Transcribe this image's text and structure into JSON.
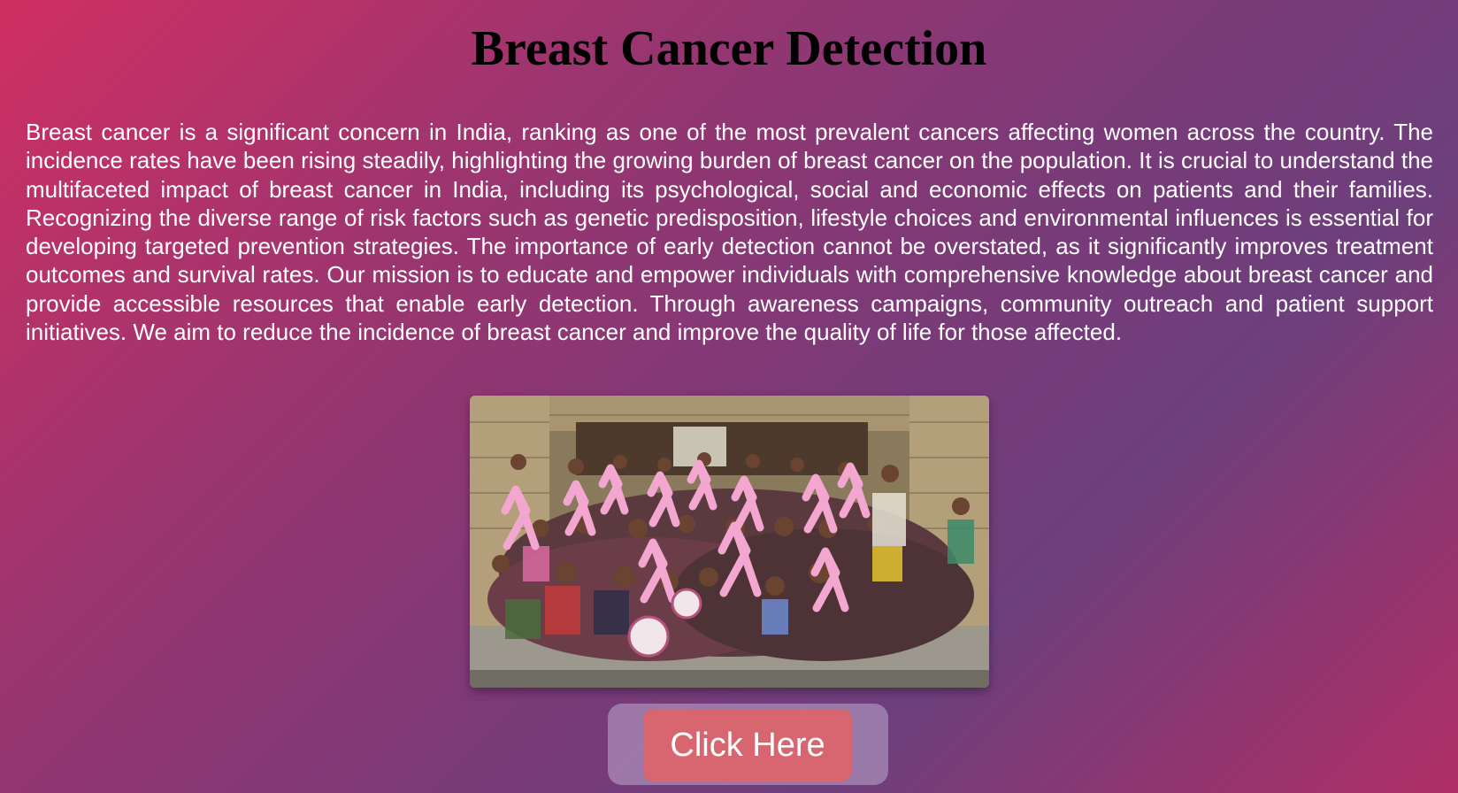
{
  "header": {
    "title": "Breast Cancer Detection"
  },
  "main": {
    "intro_text": "Breast cancer is a significant concern in India, ranking as one of the most prevalent cancers affecting women across the country. The incidence rates have been rising steadily, highlighting the growing burden of breast cancer on the population. It is crucial to understand the multifaceted impact of breast cancer in India, including its psychological, social and economic effects on patients and their families. Recognizing the diverse range of risk factors such as genetic predisposition, lifestyle choices and environmental influences is essential for developing targeted prevention strategies. The importance of early detection cannot be overstated, as it significantly improves treatment outcomes and survival rates. Our mission is to educate and empower individuals with comprehensive knowledge about breast cancer and provide accessible resources that enable early detection. Through awareness campaigns, community outreach and patient support initiatives. We aim to reduce the incidence of breast cancer and improve the quality of life for those affected.",
    "photo_icon": "awareness-group-photo",
    "cta_label": "Click Here"
  },
  "colors": {
    "background_start": "#d02f62",
    "background_mid": "#6d3f7c",
    "title": "#000000",
    "text": "#ffffff",
    "button": "#d86670",
    "ribbon": "#f3a6cf"
  }
}
